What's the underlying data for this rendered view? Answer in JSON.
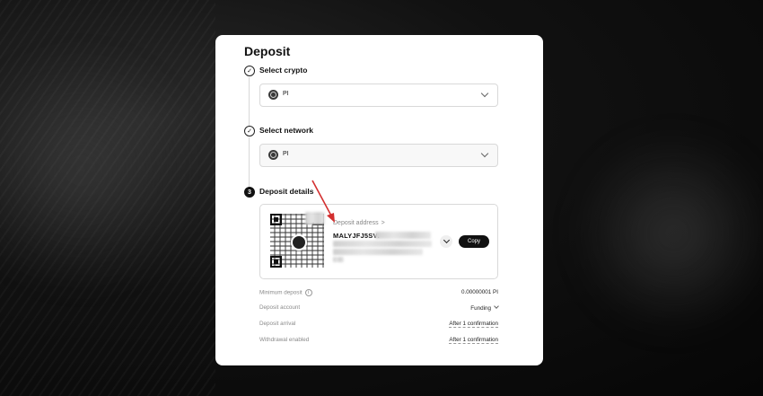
{
  "page": {
    "title": "Deposit"
  },
  "steps": {
    "select_crypto": {
      "label": "Select crypto",
      "value": "PI",
      "icon": "check-icon"
    },
    "select_network": {
      "label": "Select network",
      "value": "PI",
      "icon": "check-icon"
    },
    "deposit_details": {
      "label": "Deposit details",
      "number": "3"
    }
  },
  "deposit_address": {
    "label": "Deposit address",
    "label_arrow": ">",
    "address_visible_prefix": "MALYJFJ5SVI",
    "copy_label": "Copy"
  },
  "info": {
    "minimum_deposit": {
      "label": "Minimum deposit",
      "value": "0.00000001 PI",
      "icon": "info-icon"
    },
    "deposit_account": {
      "label": "Deposit account",
      "value": "Funding"
    },
    "deposit_arrival": {
      "label": "Deposit arrival",
      "value": "After 1 confirmation"
    },
    "withdrawal_enabled": {
      "label": "Withdrawal enabled",
      "value": "After 1 confirmation"
    }
  },
  "colors": {
    "background": "#0a0a0a",
    "card": "#ffffff",
    "accent_dark": "#111111",
    "annotation_arrow": "#d32f2f"
  }
}
